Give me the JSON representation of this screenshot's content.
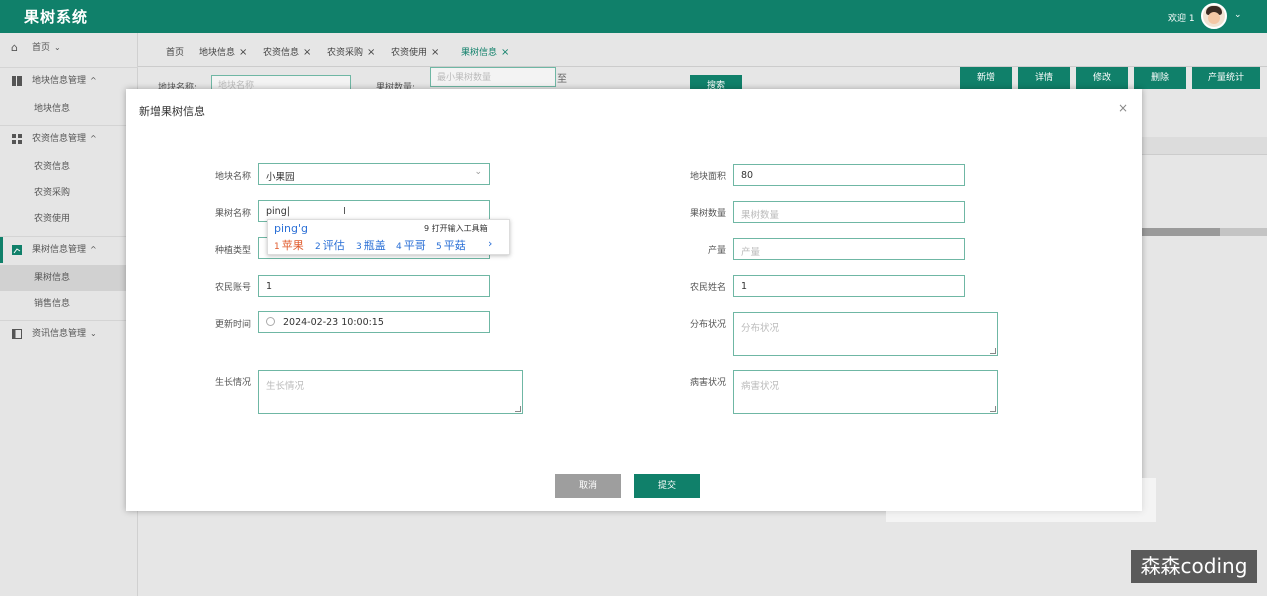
{
  "app": {
    "title": "果树系统",
    "welcome": "欢迎 1"
  },
  "sidebar": {
    "home": "首页",
    "groups": [
      {
        "label": "地块信息管理",
        "items": [
          "地块信息"
        ]
      },
      {
        "label": "农资信息管理",
        "items": [
          "农资信息",
          "农资采购",
          "农资使用"
        ]
      },
      {
        "label": "果树信息管理",
        "items": [
          "果树信息",
          "销售信息"
        ]
      },
      {
        "label": "资讯信息管理",
        "items": []
      }
    ]
  },
  "tabs": [
    "首页",
    "地块信息",
    "农资信息",
    "农资采购",
    "农资使用",
    "果树信息"
  ],
  "filter": {
    "plot_label": "地块名称:",
    "plot_placeholder": "地块名称",
    "count_label": "果树数量:",
    "count_min_placeholder": "最小果树数量",
    "range_sep": "至",
    "search": "搜索"
  },
  "toolbar": {
    "add": "新增",
    "detail": "详情",
    "edit": "修改",
    "delete": "删除",
    "stats": "产量统计"
  },
  "modal": {
    "title": "新增果树信息",
    "close": "×",
    "fields": {
      "plot_name": {
        "label": "地块名称",
        "value": "小果园"
      },
      "plot_area": {
        "label": "地块面积",
        "value": "80"
      },
      "tree_name": {
        "label": "果树名称",
        "value": "ping|"
      },
      "tree_count": {
        "label": "果树数量",
        "placeholder": "果树数量"
      },
      "plant_type": {
        "label": "种植类型"
      },
      "yield": {
        "label": "产量",
        "placeholder": "产量"
      },
      "farmer_account": {
        "label": "农民账号",
        "value": "1"
      },
      "farmer_name": {
        "label": "农民姓名",
        "value": "1"
      },
      "update_time": {
        "label": "更新时间",
        "value": "2024-02-23 10:00:15"
      },
      "distribution": {
        "label": "分布状况",
        "placeholder": "分布状况"
      },
      "growth": {
        "label": "生长情况",
        "placeholder": "生长情况"
      },
      "disease": {
        "label": "病害状况",
        "placeholder": "病害状况"
      }
    },
    "cancel": "取消",
    "submit": "提交"
  },
  "ime": {
    "composition": "ping'g",
    "toolbox": "9 打开输入工具箱",
    "candidates": [
      {
        "n": "1",
        "text": "苹果"
      },
      {
        "n": "2",
        "text": "评估"
      },
      {
        "n": "3",
        "text": "瓶盖"
      },
      {
        "n": "4",
        "text": "平哥"
      },
      {
        "n": "5",
        "text": "平菇"
      }
    ],
    "next": "›"
  },
  "watermark": "森森coding",
  "colors": {
    "primary": "#10806a",
    "border": "#6fb7a4",
    "ime_blue": "#2a6fd6",
    "ime_first": "#e05a2b"
  }
}
